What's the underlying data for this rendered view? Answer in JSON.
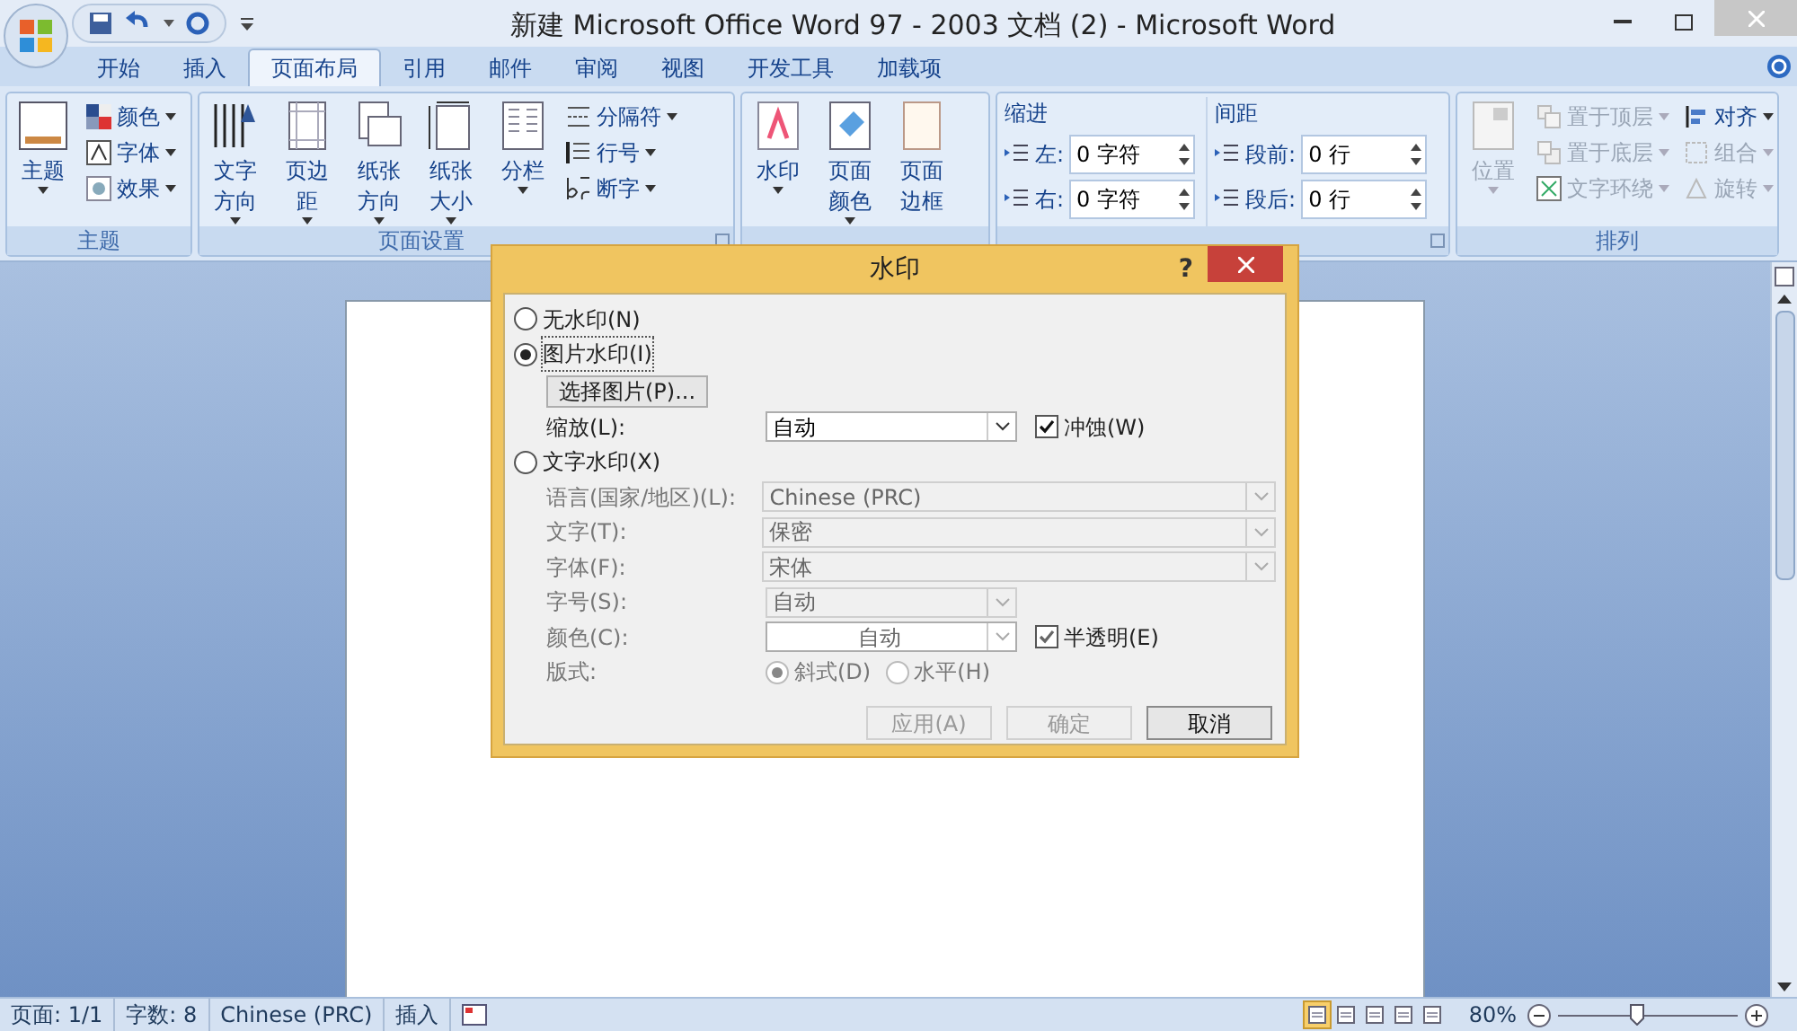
{
  "window": {
    "title": "新建 Microsoft Office Word 97 - 2003 文档 (2) - Microsoft Word"
  },
  "tabs": [
    {
      "label": "开始",
      "selected": false
    },
    {
      "label": "插入",
      "selected": false
    },
    {
      "label": "页面布局",
      "selected": true
    },
    {
      "label": "引用",
      "selected": false
    },
    {
      "label": "邮件",
      "selected": false
    },
    {
      "label": "审阅",
      "selected": false
    },
    {
      "label": "视图",
      "selected": false
    },
    {
      "label": "开发工具",
      "selected": false
    },
    {
      "label": "加载项",
      "selected": false
    }
  ],
  "ribbon_groups": [
    {
      "label": "主题",
      "items": [
        {
          "kind": "large",
          "label": "主题",
          "disabled": false
        },
        {
          "kind": "small",
          "label": "颜色",
          "disabled": false
        },
        {
          "kind": "small",
          "label": "字体",
          "disabled": false
        },
        {
          "kind": "small",
          "label": "效果",
          "disabled": false
        }
      ]
    },
    {
      "label": "页面设置",
      "items": [
        {
          "kind": "large",
          "label": "文字方向",
          "disabled": false
        },
        {
          "kind": "large",
          "label": "页边距",
          "disabled": false
        },
        {
          "kind": "large",
          "label": "纸张方向",
          "disabled": false
        },
        {
          "kind": "large",
          "label": "纸张大小",
          "disabled": false
        },
        {
          "kind": "large",
          "label": "分栏",
          "disabled": false
        },
        {
          "kind": "small",
          "label": "分隔符",
          "disabled": false
        },
        {
          "kind": "small",
          "label": "行号",
          "disabled": false
        },
        {
          "kind": "small",
          "label": "断字",
          "disabled": false
        }
      ]
    },
    {
      "items": [
        {
          "kind": "large",
          "label": "水印",
          "disabled": false
        },
        {
          "kind": "large",
          "label": "页面颜色",
          "disabled": false
        },
        {
          "kind": "large",
          "label": "页面边框",
          "disabled": false
        }
      ]
    },
    {
      "items": [
        {
          "kind": "heading",
          "label": "缩进"
        },
        {
          "kind": "spin",
          "label": "左:",
          "value": "0 字符"
        },
        {
          "kind": "spin",
          "label": "右:",
          "value": "0 字符"
        },
        {
          "kind": "heading",
          "label": "间距"
        },
        {
          "kind": "spin",
          "label": "段前:",
          "value": "0 行"
        },
        {
          "kind": "spin",
          "label": "段后:",
          "value": "0 行"
        }
      ]
    },
    {
      "label": "排列",
      "items": [
        {
          "kind": "large",
          "label": "位置",
          "disabled": true
        },
        {
          "kind": "small",
          "label": "置于顶层",
          "disabled": true
        },
        {
          "kind": "small",
          "label": "置于底层",
          "disabled": true
        },
        {
          "kind": "small",
          "label": "文字环绕",
          "disabled": true
        },
        {
          "kind": "small",
          "label": "对齐",
          "disabled": false
        },
        {
          "kind": "small",
          "label": "组合",
          "disabled": true
        },
        {
          "kind": "small",
          "label": "旋转",
          "disabled": true
        }
      ]
    }
  ],
  "dialog": {
    "title": "水印",
    "help": "?",
    "rows": [
      {
        "kind": "radio",
        "label": "无水印(N)",
        "selected": false
      },
      {
        "kind": "radio",
        "label": "图片水印(I)",
        "selected": true
      },
      {
        "kind": "button",
        "label": "选择图片(P)..."
      },
      {
        "kind": "combo",
        "label": "缩放(L):",
        "value": "自动",
        "disabled": false,
        "check": {
          "label": "冲蚀(W)",
          "checked": true
        }
      },
      {
        "kind": "radio",
        "label": "文字水印(X)",
        "selected": false
      },
      {
        "kind": "wide_combo",
        "label": "语言(国家/地区)(L):",
        "value": "Chinese (PRC)",
        "disabled": true
      },
      {
        "kind": "wide_combo",
        "label": "文字(T):",
        "value": "保密",
        "disabled": true
      },
      {
        "kind": "wide_combo",
        "label": "字体(F):",
        "value": "宋体",
        "disabled": true
      },
      {
        "kind": "combo",
        "label": "字号(S):",
        "value": "自动",
        "disabled": true
      },
      {
        "kind": "color_combo",
        "label": "颜色(C):",
        "value": "自动",
        "disabled": true,
        "check": {
          "label": "半透明(E)",
          "checked": true
        }
      },
      {
        "kind": "radio_pair",
        "label": "版式:",
        "options": [
          {
            "label": "斜式(D)",
            "selected": true
          },
          {
            "label": "水平(H)",
            "selected": false
          }
        ]
      }
    ],
    "buttons": [
      {
        "label": "应用(A)",
        "disabled": true
      },
      {
        "label": "确定",
        "disabled": true
      },
      {
        "label": "取消",
        "disabled": false
      }
    ]
  },
  "status_bar": [
    "页面: 1/1",
    "字数: 8",
    "Chinese (PRC)",
    "插入"
  ],
  "zoom": "80%",
  "zoom_slider": {
    "level": 0.44
  }
}
